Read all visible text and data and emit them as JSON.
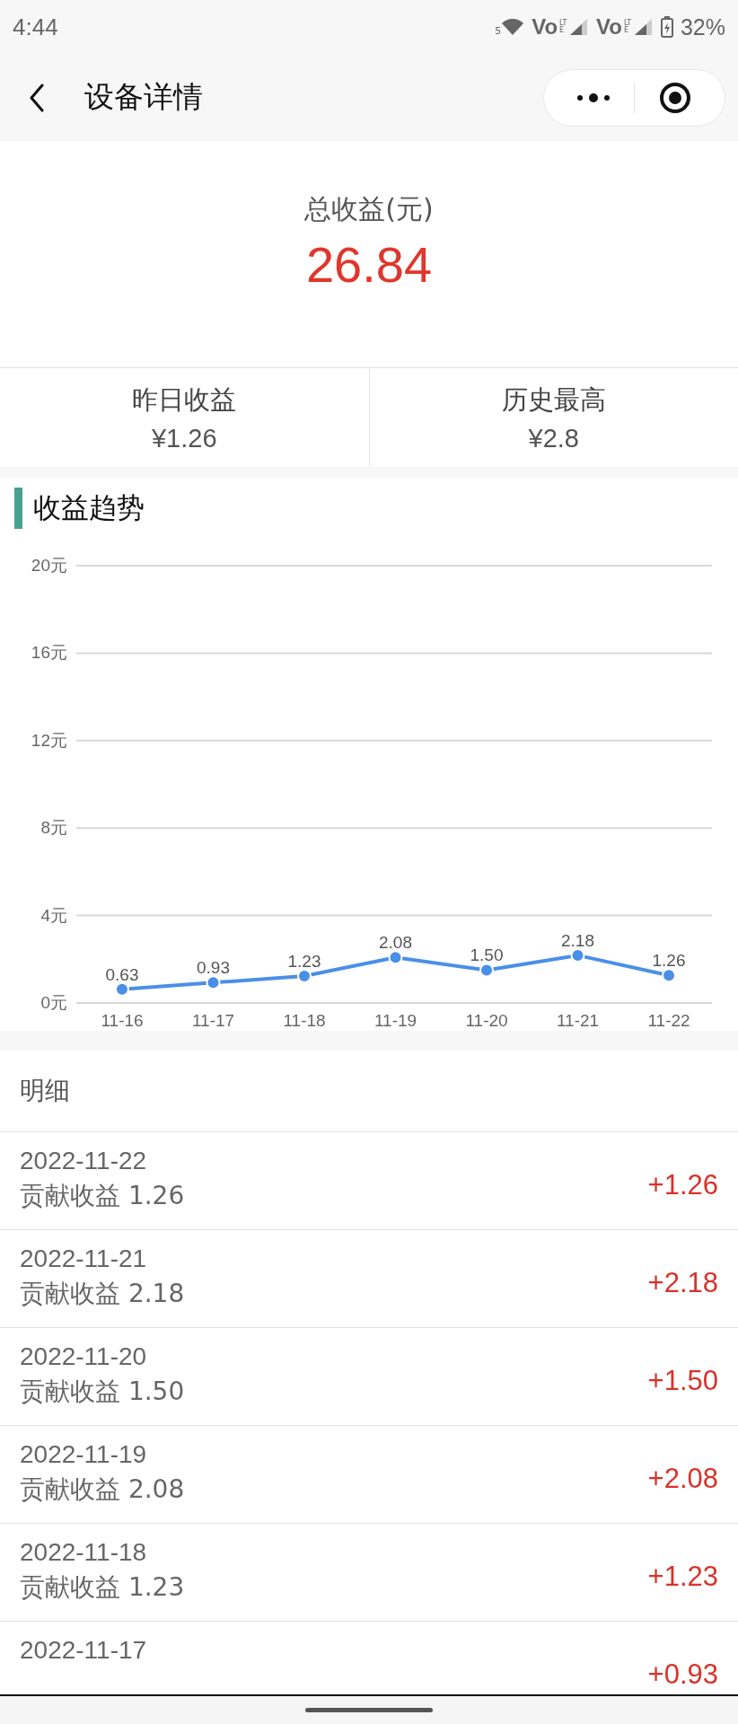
{
  "status_bar": {
    "time": "4:44",
    "wifi_badge": "5",
    "carriers": [
      {
        "label": "Vo",
        "tech": "LTE"
      },
      {
        "label": "Vo",
        "tech": "LTE"
      }
    ],
    "battery": "32%"
  },
  "nav": {
    "title": "设备详情"
  },
  "summary": {
    "label": "总收益(元)",
    "value": "26.84"
  },
  "stats": [
    {
      "label": "昨日收益",
      "value": "¥1.26"
    },
    {
      "label": "历史最高",
      "value": "¥2.8"
    }
  ],
  "trend": {
    "title": "收益趋势",
    "chart_data": {
      "type": "line",
      "categories": [
        "11-16",
        "11-17",
        "11-18",
        "11-19",
        "11-20",
        "11-21",
        "11-22"
      ],
      "series": [
        {
          "color": "#4a8fe7",
          "marker": "circle",
          "values": [
            0.63,
            0.93,
            1.23,
            2.08,
            1.5,
            2.18,
            1.26
          ]
        }
      ],
      "grid": true,
      "value_labels": [
        "0.63",
        "0.93",
        "1.23",
        "2.08",
        "1.50",
        "2.18",
        "1.26"
      ],
      "ylim": [
        0,
        20
      ],
      "yticks": [
        {
          "value": 0,
          "label": "0元"
        },
        {
          "value": 4,
          "label": "4元"
        },
        {
          "value": 8,
          "label": "8元"
        },
        {
          "value": 12,
          "label": "12元"
        },
        {
          "value": 16,
          "label": "16元"
        },
        {
          "value": 20,
          "label": "20元"
        }
      ]
    }
  },
  "details": {
    "title": "明细",
    "rows": [
      {
        "date": "2022-11-22",
        "note": "贡献收益 1.26",
        "amount": "+1.26"
      },
      {
        "date": "2022-11-21",
        "note": "贡献收益 2.18",
        "amount": "+2.18"
      },
      {
        "date": "2022-11-20",
        "note": "贡献收益 1.50",
        "amount": "+1.50"
      },
      {
        "date": "2022-11-19",
        "note": "贡献收益 2.08",
        "amount": "+2.08"
      },
      {
        "date": "2022-11-18",
        "note": "贡献收益 1.23",
        "amount": "+1.23"
      },
      {
        "date": "2022-11-17",
        "amount": "+0.93"
      }
    ]
  }
}
